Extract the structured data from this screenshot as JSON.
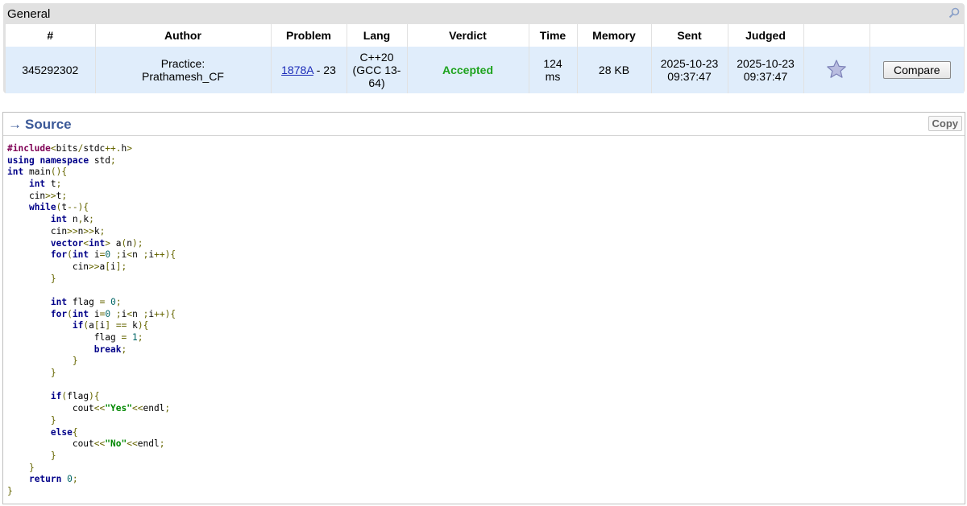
{
  "general": {
    "title": "General",
    "columns": [
      "#",
      "Author",
      "Problem",
      "Lang",
      "Verdict",
      "Time",
      "Memory",
      "Sent",
      "Judged",
      "",
      ""
    ],
    "submission": {
      "id": "345292302",
      "author_line1": "Practice:",
      "author_line2": "Prathamesh_CF",
      "problem_link": "1878A",
      "problem_rest": " - 23",
      "lang_line1": "C++20",
      "lang_line2": "(GCC 13-",
      "lang_line3": "64)",
      "verdict": "Accepted",
      "time_line1": "124",
      "time_line2": "ms",
      "memory": "28 KB",
      "sent_date": "2025-10-23",
      "sent_time": "09:37:47",
      "judged_date": "2025-10-23",
      "judged_time": "09:37:47",
      "compare_label": "Compare"
    },
    "colors": {
      "verdict": "#1ea31e",
      "row_bg": "#e0edfb",
      "link": "#1a2ab8"
    }
  },
  "source": {
    "title": "Source",
    "copy_label": "Copy",
    "code_lines": [
      "#include<bits/stdc++.h>",
      "using namespace std;",
      "int main(){",
      "    int t;",
      "    cin>>t;",
      "    while(t--){",
      "        int n,k;",
      "        cin>>n>>k;",
      "        vector<int> a(n);",
      "        for(int i=0 ;i<n ;i++){",
      "            cin>>a[i];",
      "        }",
      "",
      "        int flag = 0;",
      "        for(int i=0 ;i<n ;i++){",
      "            if(a[i] == k){",
      "                flag = 1;",
      "                break;",
      "            }",
      "        }",
      "",
      "        if(flag){",
      "            cout<<\"Yes\"<<endl;",
      "        }",
      "        else{",
      "            cout<<\"No\"<<endl;",
      "        }",
      "    }",
      "    return 0;",
      "}"
    ]
  }
}
